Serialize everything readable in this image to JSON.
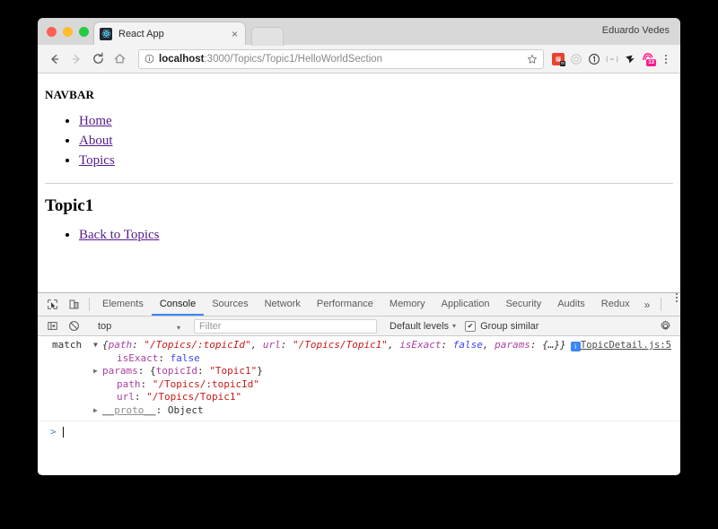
{
  "browser": {
    "window_controls": [
      "close",
      "minimize",
      "maximize"
    ],
    "tab": {
      "title": "React App",
      "favicon": "react-logo-icon",
      "close_label": "×"
    },
    "new_tab_label": "+",
    "profile_name": "Eduardo Vedes",
    "nav": {
      "back_label": "←",
      "forward_label": "→",
      "reload_label": "↻",
      "home_label": "⌂"
    },
    "omnibox": {
      "info_icon": "info-circle-icon",
      "host": "localhost",
      "path": ":3000/Topics/Topic1/HelloWorldSection",
      "full_url": "localhost:3000/Topics/Topic1/HelloWorldSection",
      "star_icon": "bookmark-star-icon"
    },
    "extensions": [
      {
        "name": "extension-red-badge",
        "label": "",
        "sub_badge": "m"
      },
      {
        "name": "extension-gray-circle",
        "label": ""
      },
      {
        "name": "extension-circled-one",
        "label": "1"
      },
      {
        "name": "extension-equalizer",
        "label": "(=)"
      },
      {
        "name": "extension-black-bird",
        "label": ""
      },
      {
        "name": "extension-pink-counter",
        "label": "",
        "count": "13"
      }
    ],
    "menu_label": "⋮"
  },
  "page": {
    "navbar_heading": "NAVBAR",
    "nav_links": [
      "Home",
      "About",
      "Topics"
    ],
    "topic_heading": "Topic1",
    "topic_links": [
      "Back to Topics"
    ]
  },
  "devtools": {
    "left_icons": [
      "inspect-element-icon",
      "device-toolbar-icon"
    ],
    "tabs": [
      {
        "label": "Elements",
        "active": false
      },
      {
        "label": "Console",
        "active": true
      },
      {
        "label": "Sources",
        "active": false
      },
      {
        "label": "Network",
        "active": false
      },
      {
        "label": "Performance",
        "active": false
      },
      {
        "label": "Memory",
        "active": false
      },
      {
        "label": "Application",
        "active": false
      },
      {
        "label": "Security",
        "active": false
      },
      {
        "label": "Audits",
        "active": false
      },
      {
        "label": "Redux",
        "active": false
      }
    ],
    "more_tabs_label": "»",
    "panel_menu_label": "⋮",
    "panel_close_label": "×",
    "filterbar": {
      "sidebar_toggle_icon": "console-sidebar-icon",
      "clear_console_icon": "clear-console-icon",
      "context_value": "top",
      "context_caret": "▾",
      "filter_placeholder": "Filter",
      "filter_value": "",
      "levels_label": "Default levels",
      "levels_caret": "▾",
      "group_similar_label": "Group similar",
      "group_similar_checked": true,
      "checkmark": "✔",
      "settings_icon": "gear-icon"
    },
    "console": {
      "message": {
        "label": "match",
        "source_link": "TopicDetail.js:5",
        "info_badge": "i",
        "expanded": true,
        "preview": {
          "open_brace": "{",
          "close_brace": "}",
          "entries": [
            {
              "key": "path",
              "sep": ": ",
              "value": "\"/Topics/:topicId\"",
              "type": "string"
            },
            {
              "key": "url",
              "sep": ": ",
              "value": "\"/Topics/Topic1\"",
              "type": "string"
            },
            {
              "key": "isExact",
              "sep": ": ",
              "value": "false",
              "type": "boolean"
            },
            {
              "key": "params",
              "sep": ": ",
              "value": "{…}",
              "type": "object"
            }
          ]
        },
        "properties": [
          {
            "expandable": false,
            "key": "isExact",
            "value": "false",
            "type": "boolean"
          },
          {
            "expandable": true,
            "key": "params",
            "value": "{topicId: \"Topic1\"}",
            "type": "object-preview"
          },
          {
            "expandable": false,
            "key": "path",
            "value": "\"/Topics/:topicId\"",
            "type": "string"
          },
          {
            "expandable": false,
            "key": "url",
            "value": "\"/Topics/Topic1\"",
            "type": "string"
          },
          {
            "expandable": true,
            "key": "__proto__",
            "value": "Object",
            "type": "proto"
          }
        ]
      },
      "prompt_symbol": ">",
      "prompt_value": ""
    }
  }
}
